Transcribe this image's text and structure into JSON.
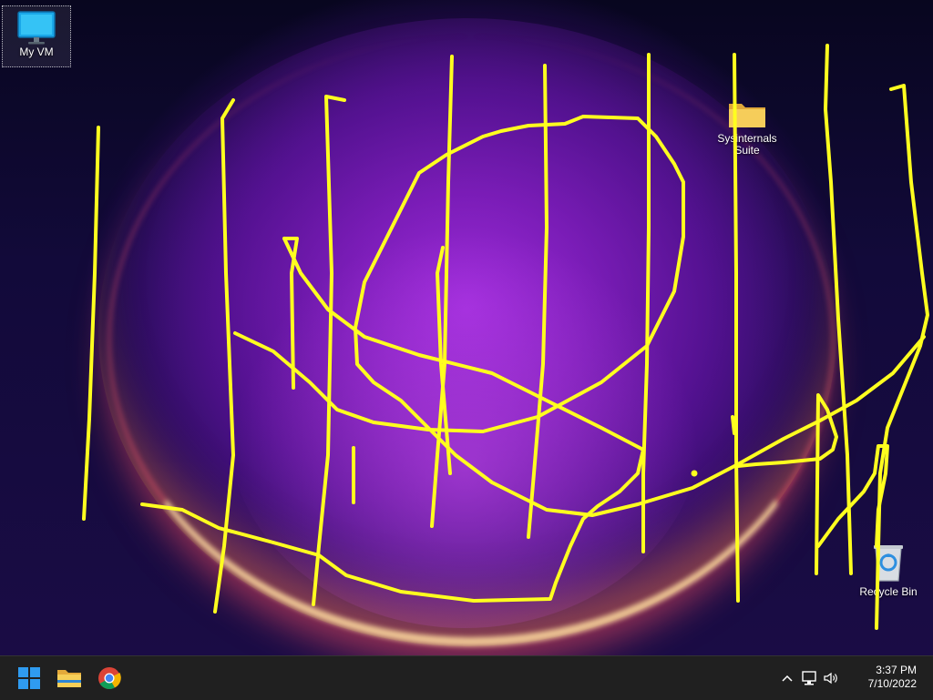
{
  "desktop": {
    "icons": [
      {
        "label": "My VM"
      },
      {
        "label_line1": "Sysinternals",
        "label_line2": "Suite"
      },
      {
        "label": "Recycle Bin"
      }
    ]
  },
  "taskbar": {
    "pinned": [
      "start-icon",
      "file-explorer-icon",
      "chrome-icon"
    ],
    "tray": [
      "chevron-up-icon",
      "network-icon",
      "volume-icon"
    ],
    "clock": {
      "time": "3:37 PM",
      "date": "7/10/2022"
    }
  },
  "colors": {
    "annotation": "#ffff1f",
    "taskbar": "#202020",
    "accent": "#0078d4"
  }
}
